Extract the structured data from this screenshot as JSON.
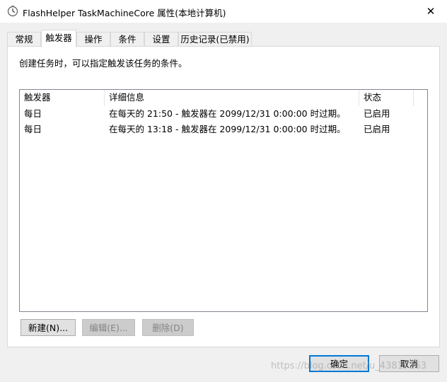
{
  "window": {
    "title": "FlashHelper TaskMachineCore 属性(本地计算机)",
    "close_glyph": "✕"
  },
  "tabs": [
    {
      "label": "常规",
      "active": false
    },
    {
      "label": "触发器",
      "active": true
    },
    {
      "label": "操作",
      "active": false
    },
    {
      "label": "条件",
      "active": false
    },
    {
      "label": "设置",
      "active": false
    },
    {
      "label": "历史记录(已禁用)",
      "active": false
    }
  ],
  "panel": {
    "description": "创建任务时，可以指定触发该任务的条件。"
  },
  "trigger_list": {
    "columns": [
      "触发器",
      "详细信息",
      "状态"
    ],
    "rows": [
      [
        "每日",
        "在每天的 21:50 - 触发器在 2099/12/31 0:00:00 时过期。",
        "已启用"
      ],
      [
        "每日",
        "在每天的 13:18 - 触发器在 2099/12/31 0:00:00 时过期。",
        "已启用"
      ]
    ]
  },
  "list_buttons": {
    "new": "新建(N)...",
    "edit": "编辑(E)...",
    "delete": "删除(D)"
  },
  "dialog_buttons": {
    "ok": "确定",
    "cancel": "取消"
  },
  "watermark": "https://blog.csdn.net/u_43817263",
  "colors": {
    "accent": "#0078d7",
    "panel_background": "#ffffff",
    "window_background": "#f0f0f0"
  }
}
